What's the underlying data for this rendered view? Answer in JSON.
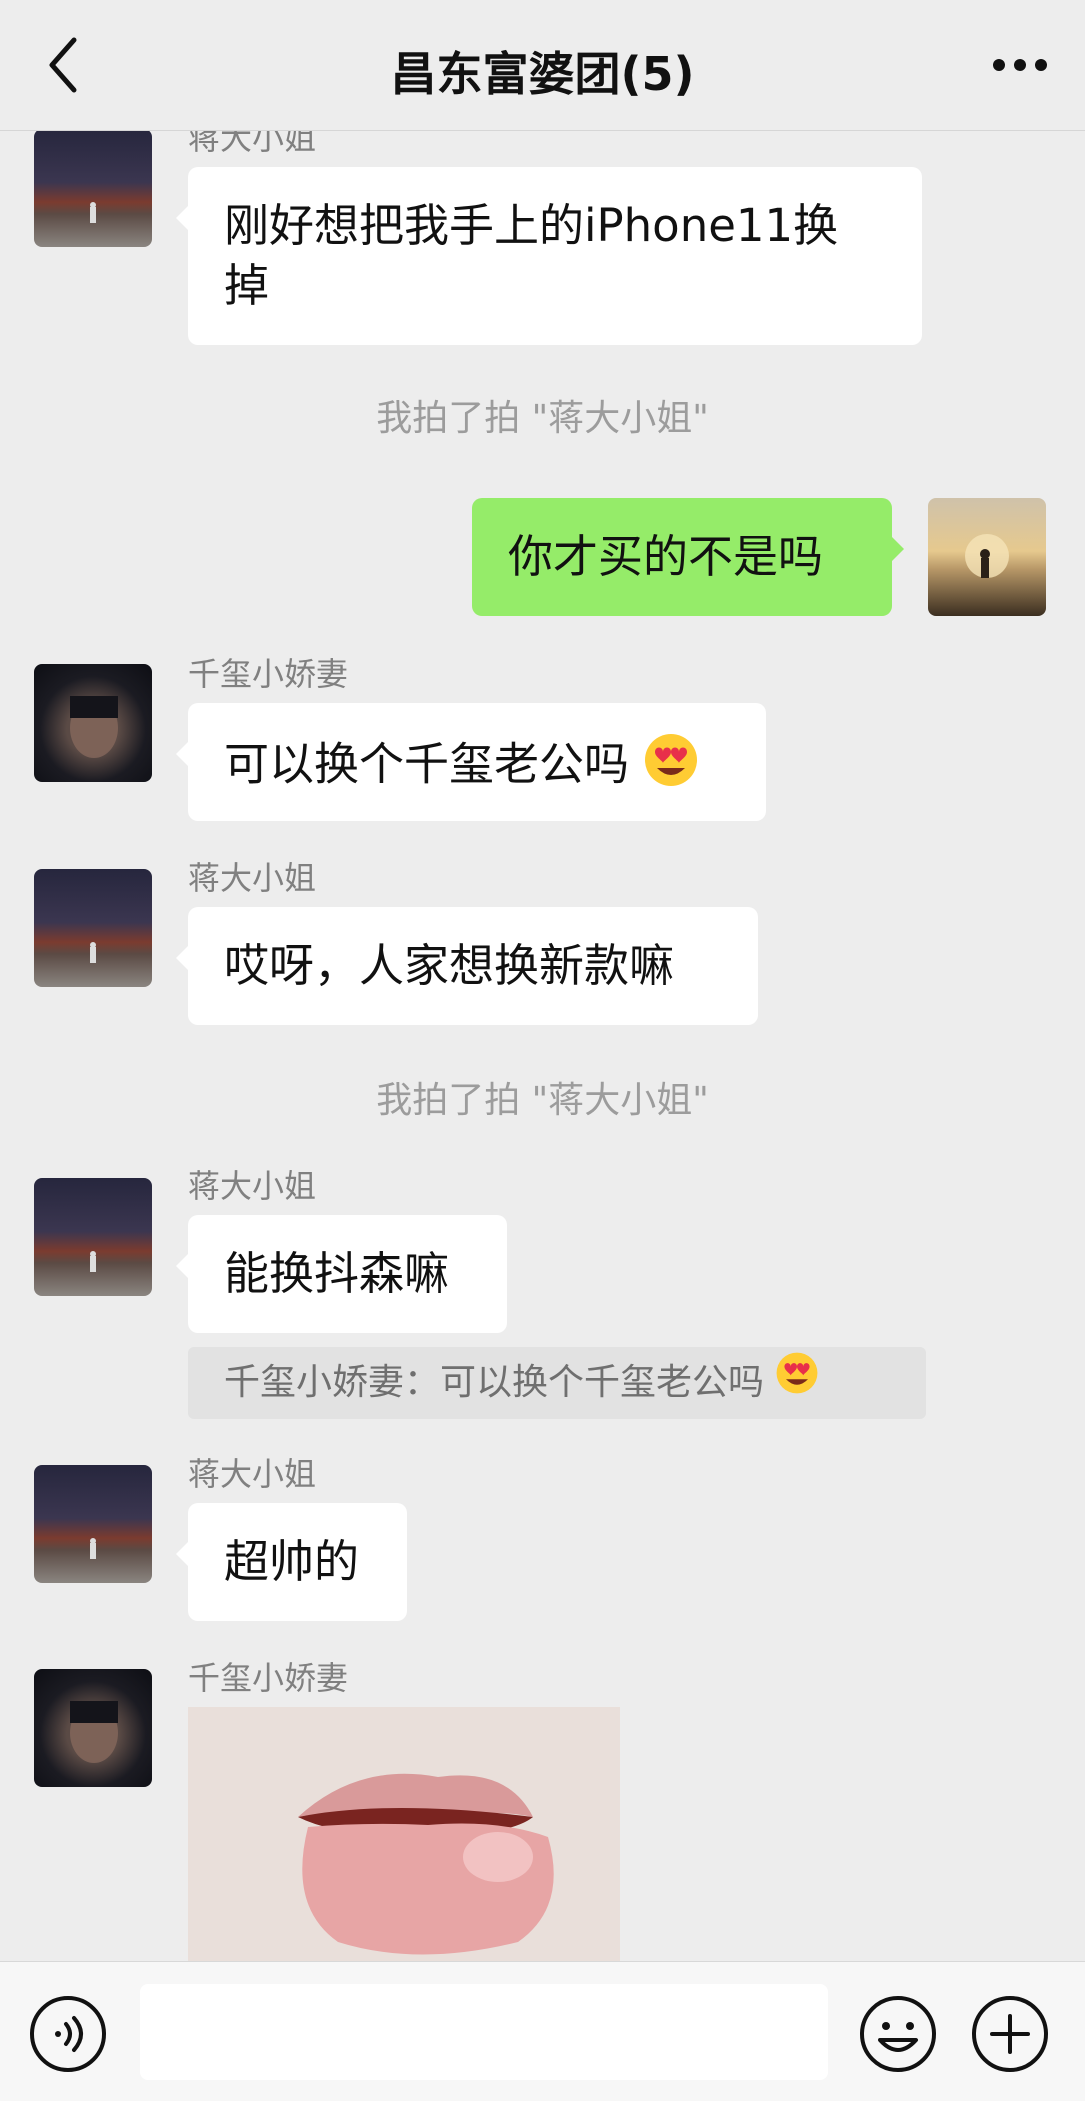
{
  "header": {
    "title": "昌东富婆团(5)"
  },
  "messages": {
    "m1": {
      "sender": "蒋大小姐",
      "line1": "刚好想把我手上的iPhone11换",
      "line2": "掉"
    },
    "sys1": "我拍了拍 \"蒋大小姐\"",
    "m2": {
      "text": "你才买的不是吗"
    },
    "m3": {
      "sender": "千玺小娇妻",
      "text": "可以换个千玺老公吗"
    },
    "m4": {
      "sender": "蒋大小姐",
      "text": "哎呀，人家想换新款嘛"
    },
    "sys2": "我拍了拍 \"蒋大小姐\"",
    "m5": {
      "sender": "蒋大小姐",
      "text": "能换抖森嘛",
      "quote": "千玺小娇妻：可以换个千玺老公吗"
    },
    "m6": {
      "sender": "蒋大小姐",
      "text": "超帅的"
    },
    "m7": {
      "sender": "千玺小娇妻"
    }
  },
  "colors": {
    "my_bubble": "#95ec69",
    "their_bubble": "#ffffff",
    "background": "#ededed"
  }
}
